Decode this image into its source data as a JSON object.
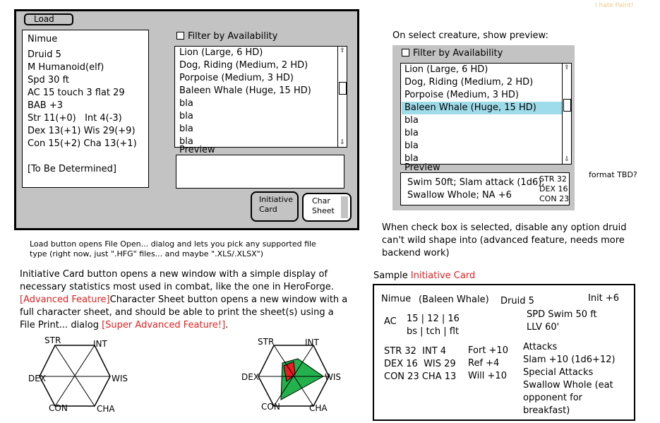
{
  "hint_top": "I hate Paint!",
  "app": {
    "load_label": "Load",
    "stats": [
      "Nimue",
      "Druid 5",
      "M Humanoid(elf)",
      "Spd 30 ft",
      "AC 15 touch 3 flat 29",
      "BAB +3",
      "Str 11(+0)   Int 4(-3)",
      "Dex 13(+1) Wis 29(+9)",
      "Con 15(+2) Cha 13(+1)",
      "[To Be Determined]"
    ],
    "filter_label": "Filter by Availability",
    "creatures": [
      "Lion (Large, 6 HD)",
      "Dog, Riding (Medium, 2 HD)",
      "Porpoise (Medium, 3 HD)",
      "Baleen Whale (Huge, 15 HD)",
      "bla",
      "bla",
      "bla",
      "bla"
    ],
    "preview_label": "Preview",
    "initiative_label_1": "Initiative",
    "initiative_label_2": "Card",
    "charsheet_label_1": "Char",
    "charsheet_label_2": "Sheet"
  },
  "notes": {
    "load_1": "Load button opens File Open... dialog and lets you pick any supported file",
    "load_2": "type (right now, just \".HFG\" files... and maybe \".XLS/.XLSX\")",
    "init_1": "Initiative Card button opens a new window with a simple display of",
    "init_2": "necessary statistics most used in combat, like the one in HeroForge.",
    "init_3a": "[Advanced Feature]",
    "init_3b": "Character Sheet button opens a new window with a",
    "init_4": "full character sheet, and should be able to print the sheet(s) using a",
    "init_5a": "File Print... dialog ",
    "init_5b": "[Super Advanced Feature!]",
    "init_5c": ".",
    "select_title": "On select creature, show preview:",
    "check_1": "When check box is selected, disable any option druid",
    "check_2": "can't wild shape into (advanced feature, needs more",
    "check_3": "backend work)",
    "format_tbd": "format TBD?"
  },
  "preview_panel": {
    "filter_label": "Filter by Availability",
    "creatures": [
      "Lion (Large, 6 HD)",
      "Dog, Riding (Medium, 2 HD)",
      "Porpoise (Medium, 3 HD)",
      "Baleen Whale (Huge, 15 HD)",
      "bla",
      "bla",
      "bla",
      "bla"
    ],
    "selected_index": 3,
    "preview_label": "Preview",
    "preview_line1": "Swim 50ft; Slam attack (1d6),",
    "preview_line2": "Swallow Whole; NA +6",
    "preview_stats": [
      "STR 32",
      "DEX 16",
      "CON 23"
    ]
  },
  "card": {
    "sample_prefix": "Sample ",
    "sample_title": "Initiative Card",
    "name": "Nimue",
    "form": "(Baleen Whale)",
    "class": "Druid 5",
    "init": "Init +6",
    "ac_label": "AC",
    "ac_values": "15 | 12 | 16",
    "ac_types": "bs | tch | flt",
    "spd": "SPD Swim 50 ft",
    "llv": "LLV 60'",
    "ab1": "STR 32  INT 4",
    "ab2": "DEX 16  WIS 29",
    "ab3": "CON 23 CHA 13",
    "save1": "Fort +10",
    "save2": "Ref +4",
    "save3": "Will +10",
    "attacks": [
      "Attacks",
      "Slam +10 (1d6+12)",
      "Special Attacks",
      "Swallow Whole (eat",
      "opponent for",
      "breakfast)"
    ]
  },
  "radar_labels": {
    "str": "STR",
    "int": "INT",
    "wis": "WIS",
    "cha": "CHA",
    "con": "CON",
    "dex": "DEX"
  },
  "colors": {
    "window_bg": "#c3c3c3",
    "selected_row": "#9fdcea",
    "red_text": "#e02020",
    "hint_text": "#f2c98a",
    "radar_green": "#22b14c",
    "radar_red": "#ed1c24"
  }
}
